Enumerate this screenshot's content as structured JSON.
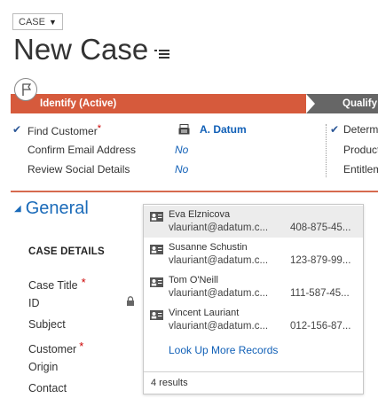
{
  "header": {
    "entity_label": "CASE",
    "entity_caret": "▼",
    "title": "New Case"
  },
  "process": {
    "active_stage": "Identify (Active)",
    "next_stage": "Qualify"
  },
  "steps_left": [
    {
      "check": "✔",
      "label": "Find Customer",
      "required": "*",
      "value": "A. Datum"
    },
    {
      "check": "",
      "label": "Confirm Email Address",
      "required": "",
      "value": "No"
    },
    {
      "check": "",
      "label": "Review Social Details",
      "required": "",
      "value": "No"
    }
  ],
  "steps_right": [
    {
      "check": "✔",
      "label": "Determ"
    },
    {
      "check": "",
      "label": "Product"
    },
    {
      "check": "",
      "label": "Entitlem"
    }
  ],
  "section": {
    "title": "General",
    "subsection": "CASE DETAILS",
    "fields": [
      {
        "label": "Case Title",
        "required": "*"
      },
      {
        "label": "ID",
        "required": ""
      },
      {
        "label": "Subject",
        "required": ""
      },
      {
        "label": "Customer",
        "required": "*"
      },
      {
        "label": "Origin",
        "required": ""
      },
      {
        "label": "Contact",
        "required": ""
      }
    ]
  },
  "lookup": {
    "results": [
      {
        "name": "Eva Elznicova",
        "email": "vlauriant@adatum.c...",
        "phone": "408-875-45..."
      },
      {
        "name": "Susanne Schustin",
        "email": "vlauriant@adatum.c...",
        "phone": "123-879-99..."
      },
      {
        "name": "Tom O'Neill",
        "email": "vlauriant@adatum.c...",
        "phone": "111-587-45..."
      },
      {
        "name": "Vincent Lauriant",
        "email": "vlauriant@adatum.c...",
        "phone": "012-156-87..."
      }
    ],
    "more_link": "Look Up More Records",
    "result_count": "4 results"
  },
  "colors": {
    "active_stage": "#d65a3c",
    "next_stage": "#666666",
    "accent": "#1160b7",
    "required": "#cc0000"
  }
}
